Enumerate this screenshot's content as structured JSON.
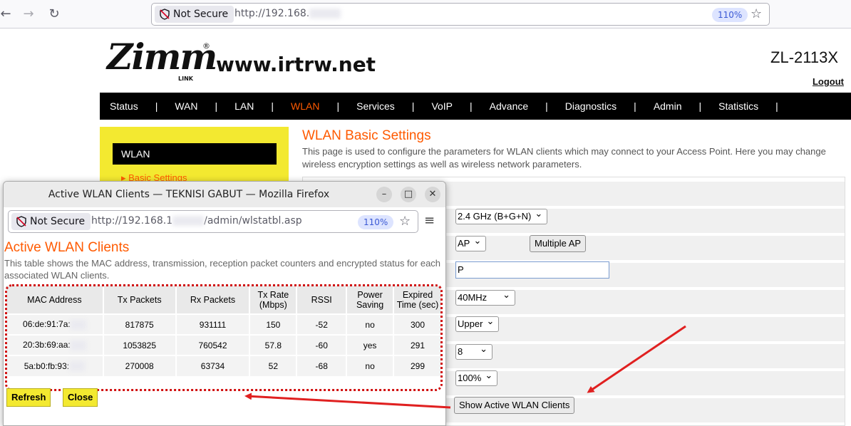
{
  "browser": {
    "security_label": "Not Secure",
    "url": "http://192.168.",
    "zoom": "110%"
  },
  "header": {
    "logo_text": "Zimm",
    "logo_sub": "LINK",
    "logo_reg": "®",
    "site_url": "www.irtrw.net",
    "model": "ZL-2113X",
    "logout": "Logout"
  },
  "menu": [
    {
      "label": "Status",
      "sep": "|"
    },
    {
      "label": "WAN",
      "sep": "|"
    },
    {
      "label": "LAN",
      "sep": "|"
    },
    {
      "label": "WLAN",
      "sep": "|"
    },
    {
      "label": "Services",
      "sep": "|"
    },
    {
      "label": "VoIP",
      "sep": "|"
    },
    {
      "label": "Advance",
      "sep": "|"
    },
    {
      "label": "Diagnostics",
      "sep": "|"
    },
    {
      "label": "Admin",
      "sep": "|"
    },
    {
      "label": "Statistics",
      "sep": "|"
    }
  ],
  "sidebar": {
    "heading": "WLAN",
    "link": "Basic Settings"
  },
  "main": {
    "title": "WLAN Basic Settings",
    "description": "This page is used to configure the parameters for WLAN clients which may connect to your Access Point. Here you may change wireless encryption settings as well as wireless network parameters.",
    "band": "2.4 GHz (B+G+N)",
    "mode": "AP",
    "multiple_ap": "Multiple AP",
    "ssid": "P",
    "channel_width": "40MHz",
    "control_sideband": "Upper",
    "channel": "8",
    "tx_power": "100%",
    "show_clients": "Show Active WLAN Clients"
  },
  "popup": {
    "window_title": "Active WLAN Clients — TEKNISI GABUT — Mozilla Firefox",
    "security_label": "Not Secure",
    "url_prefix": "http://192.168.1",
    "url_suffix": "/admin/wlstatbl.asp",
    "zoom": "110%",
    "heading": "Active WLAN Clients",
    "description": "This table shows the MAC address, transmission, reception packet counters and encrypted status for each associated WLAN clients.",
    "columns": [
      "MAC Address",
      "Tx Packets",
      "Rx Packets",
      "Tx Rate (Mbps)",
      "RSSI",
      "Power Saving",
      "Expired Time (sec)"
    ],
    "rows": [
      [
        "06:de:91:7a:",
        "817875",
        "931111",
        "150",
        "-52",
        "no",
        "300"
      ],
      [
        "20:3b:69:aa:",
        "1053825",
        "760542",
        "57.8",
        "-60",
        "yes",
        "291"
      ],
      [
        "5a:b0:fb:93:",
        "270008",
        "63734",
        "52",
        "-68",
        "no",
        "299"
      ]
    ],
    "refresh": "Refresh",
    "close": "Close"
  },
  "colors": {
    "accent": "#ff5a00",
    "annotation": "#e02020",
    "sidebar_bg": "#f3e930"
  }
}
